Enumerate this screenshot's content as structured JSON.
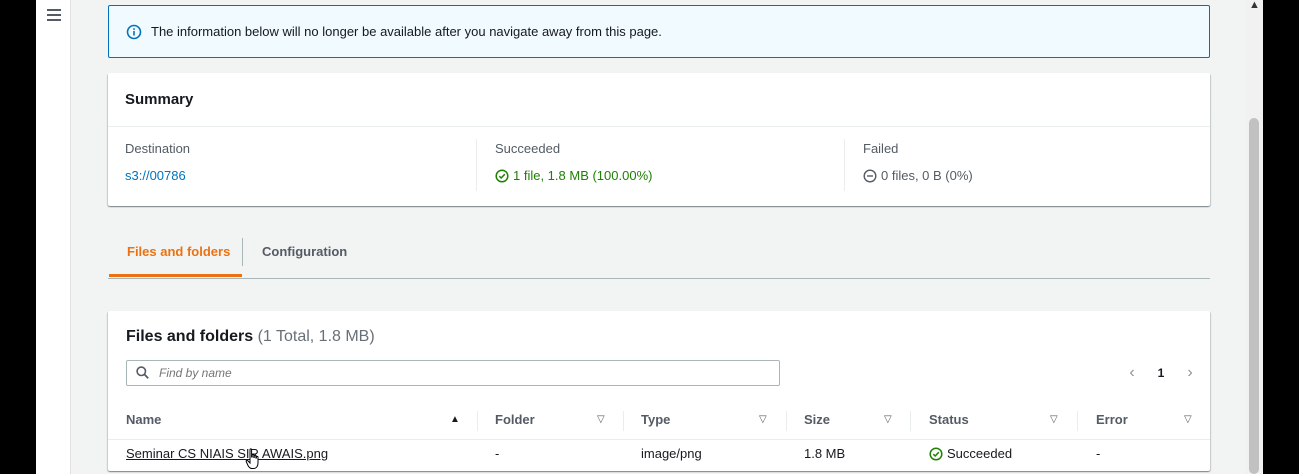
{
  "flash": {
    "icon": "info-icon",
    "message": "The information below will no longer be available after you navigate away from this page."
  },
  "summary": {
    "title": "Summary",
    "destination_label": "Destination",
    "destination_value": "s3://00786",
    "succeeded_label": "Succeeded",
    "succeeded_value": "1 file, 1.8 MB (100.00%)",
    "failed_label": "Failed",
    "failed_value": "0 files, 0 B (0%)"
  },
  "tabs": [
    {
      "label": "Files and folders",
      "active": true
    },
    {
      "label": "Configuration",
      "active": false
    }
  ],
  "files": {
    "title": "Files and folders",
    "count": "(1 Total, 1.8 MB)",
    "search_placeholder": "Find by name",
    "page": "1",
    "columns": [
      "Name",
      "Folder",
      "Type",
      "Size",
      "Status",
      "Error"
    ],
    "rows": [
      {
        "name": "Seminar CS NIAIS SIR AWAIS.png",
        "folder": "-",
        "type": "image/png",
        "size": "1.8 MB",
        "status": "Succeeded",
        "error": "-"
      }
    ]
  },
  "colors": {
    "accent": "#ec7211",
    "link": "#0073bb",
    "success": "#1d8102",
    "info_border": "#0073bb"
  }
}
